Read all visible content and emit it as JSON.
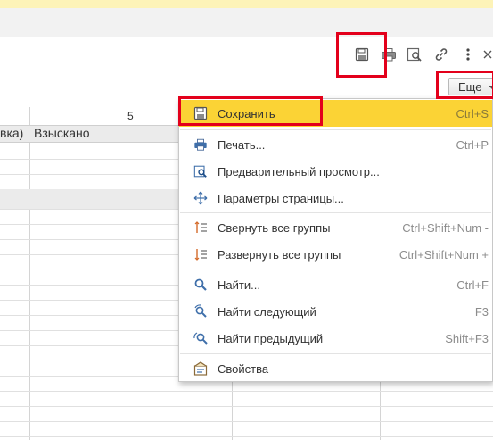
{
  "toolbar": {
    "icons": [
      "save-icon",
      "print-icon",
      "preview-icon",
      "link-icon",
      "more-vert-icon"
    ],
    "more_label": "Еще"
  },
  "sheet": {
    "column_number": "5",
    "header_left": "вка)",
    "header_main": "Взыскано"
  },
  "menu": {
    "items": [
      {
        "label": "Сохранить",
        "shortcut": "Ctrl+S",
        "icon": "save-icon"
      },
      {
        "label": "Печать...",
        "shortcut": "Ctrl+P",
        "icon": "print-icon"
      },
      {
        "label": "Предварительный просмотр...",
        "shortcut": "",
        "icon": "preview-icon"
      },
      {
        "label": "Параметры страницы...",
        "shortcut": "",
        "icon": "page-settings-icon"
      },
      {
        "label": "Свернуть все группы",
        "shortcut": "Ctrl+Shift+Num -",
        "icon": "collapse-groups-icon"
      },
      {
        "label": "Развернуть все группы",
        "shortcut": "Ctrl+Shift+Num +",
        "icon": "expand-groups-icon"
      },
      {
        "label": "Найти...",
        "shortcut": "Ctrl+F",
        "icon": "search-icon"
      },
      {
        "label": "Найти следующий",
        "shortcut": "F3",
        "icon": "find-next-icon"
      },
      {
        "label": "Найти предыдущий",
        "shortcut": "Shift+F3",
        "icon": "find-previous-icon"
      },
      {
        "label": "Свойства",
        "shortcut": "",
        "icon": "properties-icon"
      }
    ]
  },
  "colors": {
    "highlight": "#fbd335",
    "annotation": "#e3001b",
    "top_strip": "#fdf3b8"
  }
}
